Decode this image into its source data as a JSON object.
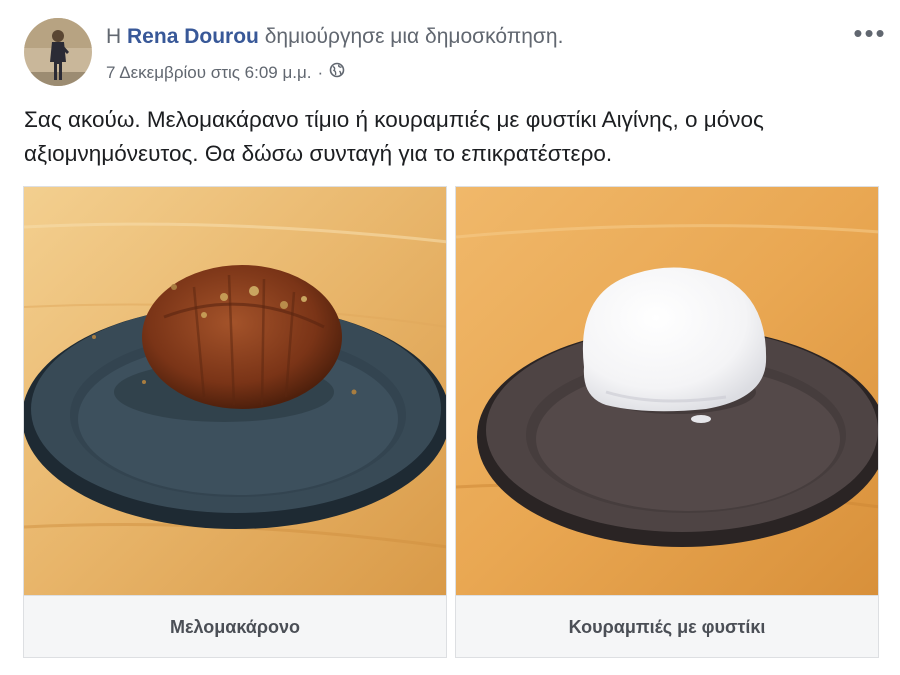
{
  "header": {
    "prefix": "Η",
    "author": "Rena Dourou",
    "action": "δημιούργησε μια δημοσκόπηση.",
    "timestamp": "7 Δεκεμβρίου στις 6:09 μ.μ.",
    "separator": "·",
    "audience_icon": "globe-icon",
    "more_icon": "more-options-icon",
    "more_glyph": "•••"
  },
  "post": {
    "text": "Σας ακούω. Μελομακάρανο τίμιο ή κουραμπιές με φυστίκι Αιγίνης, ο μόνος αξιομνημόνευτος. Θα δώσω συνταγή για το επικρατέστερο."
  },
  "poll": {
    "options": [
      {
        "label": "Μελομακάρονο"
      },
      {
        "label": "Κουραμπιές με φυστίκι"
      }
    ]
  },
  "colors": {
    "author_link": "#385898",
    "secondary_text": "#616770",
    "border": "#dddfe2",
    "label_bg": "#f5f6f7"
  }
}
